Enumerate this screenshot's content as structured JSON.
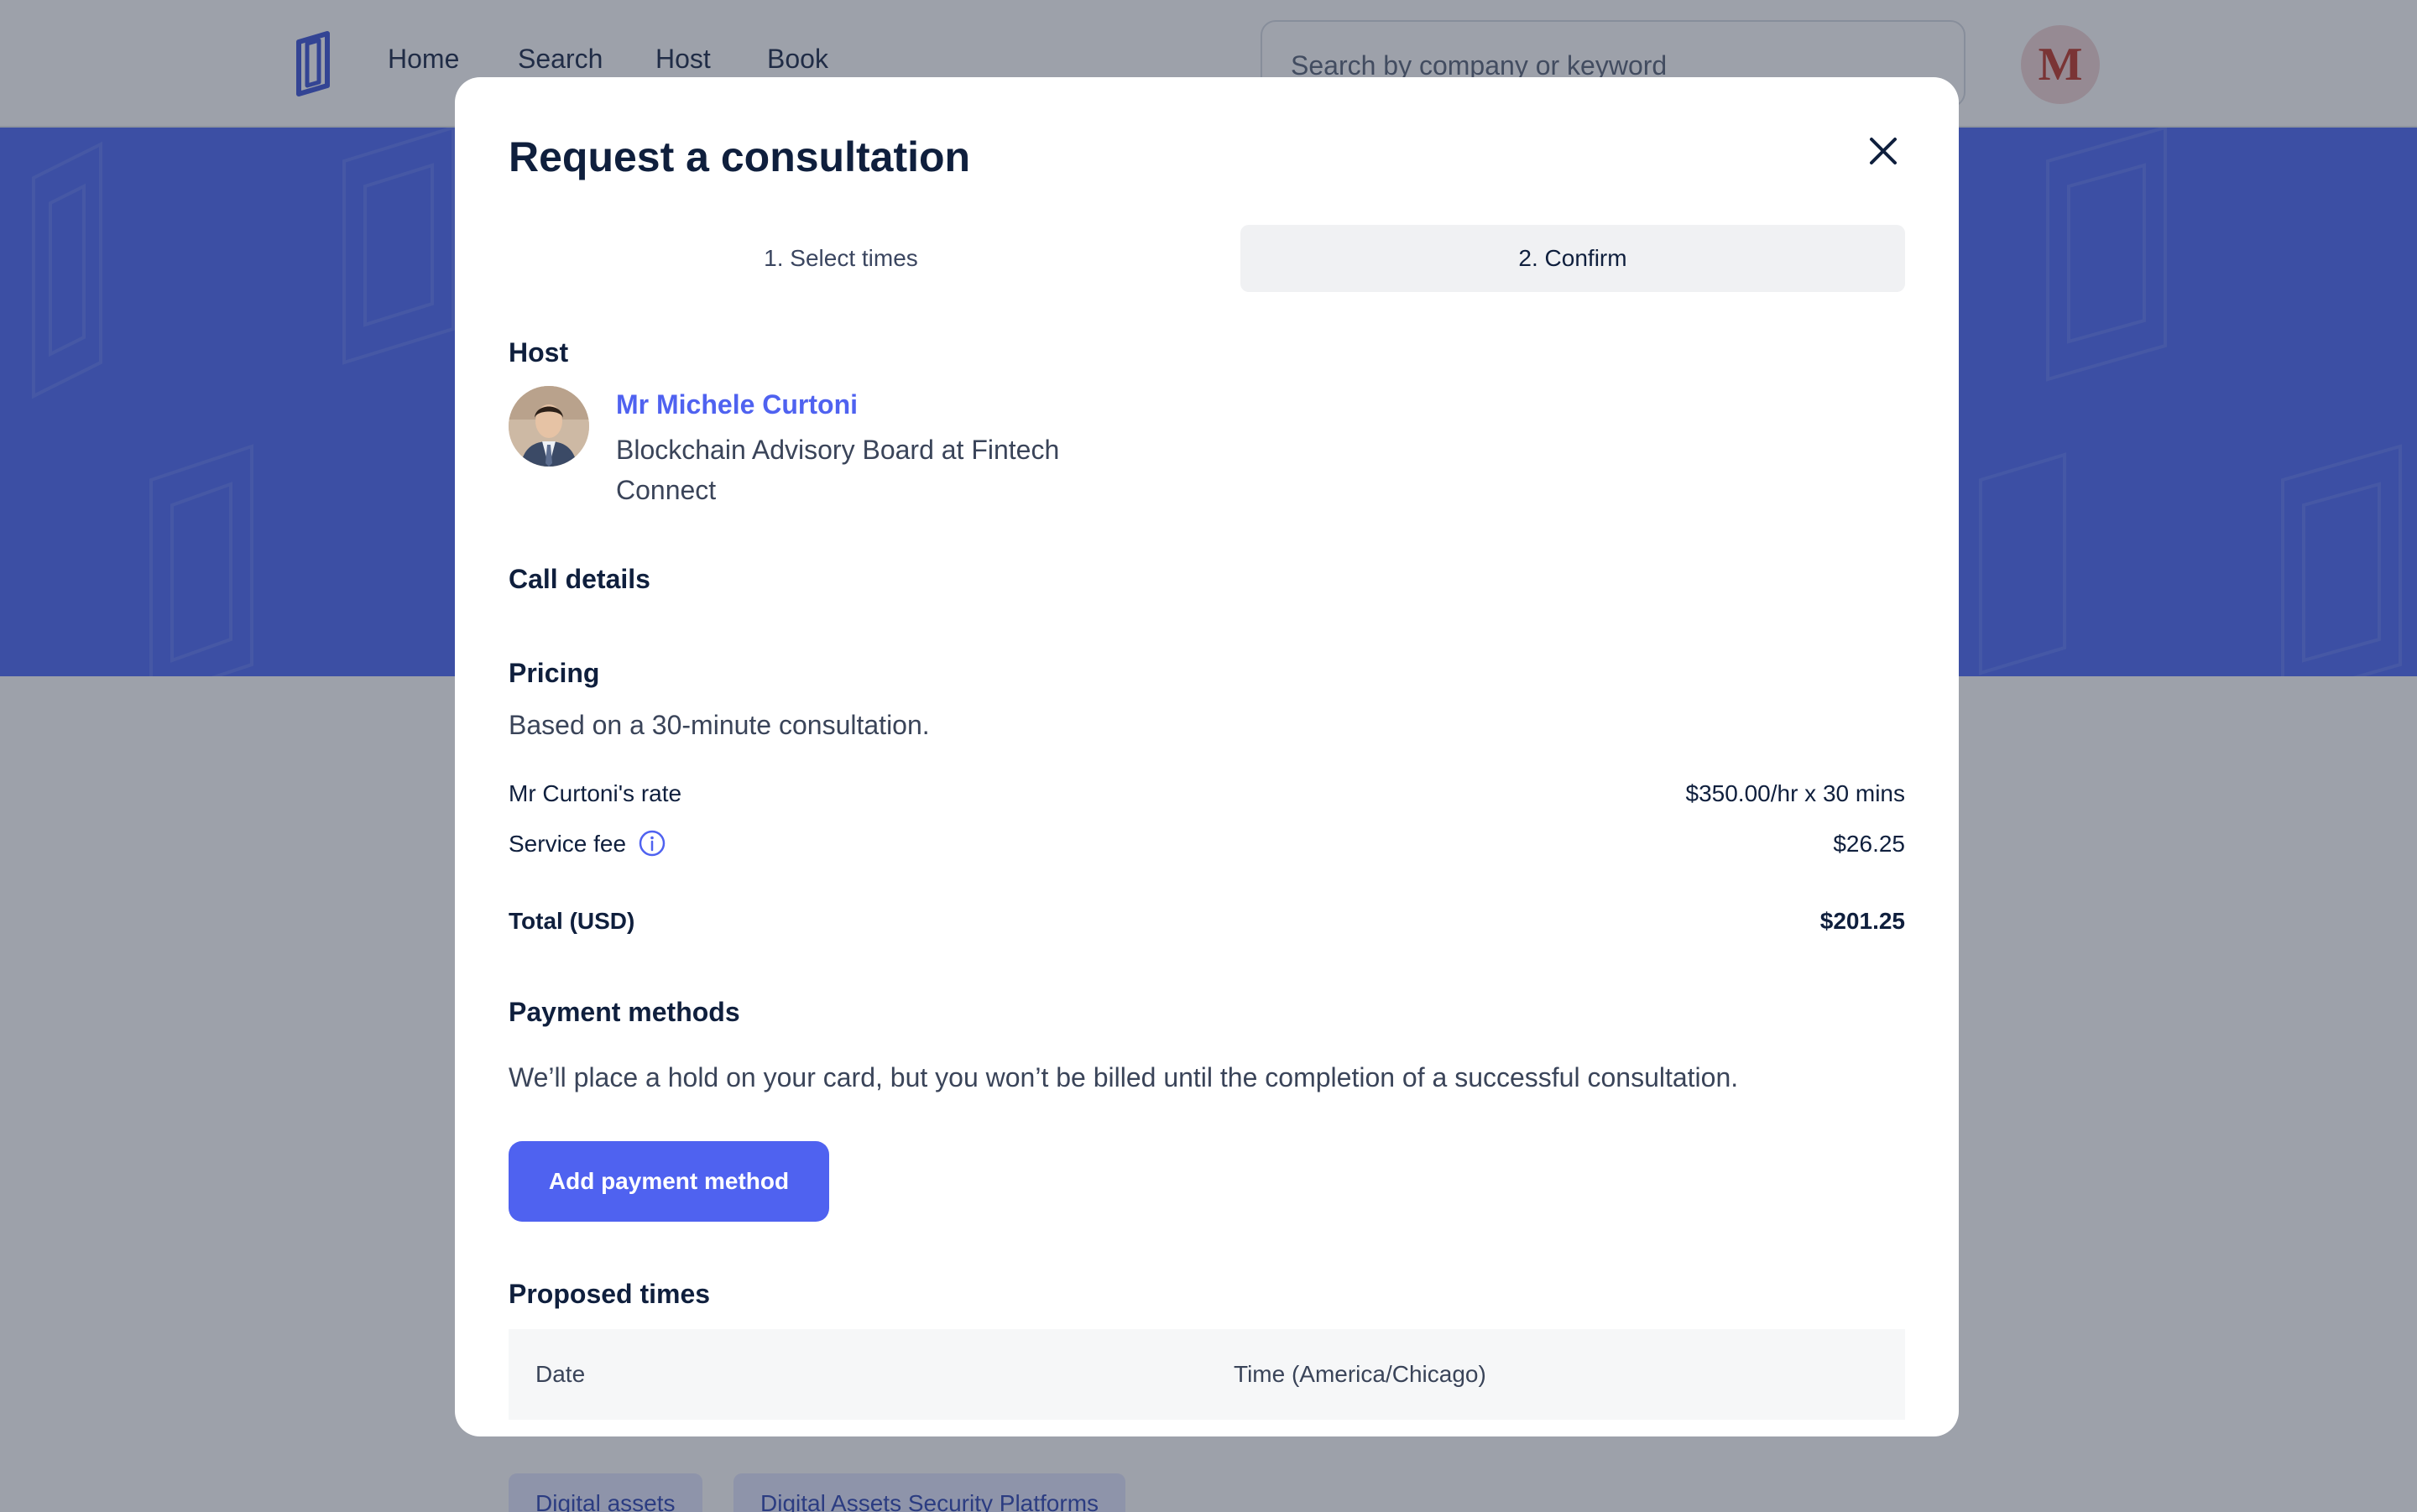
{
  "nav": {
    "links": [
      "Home",
      "Search",
      "Host",
      "Book"
    ],
    "search_placeholder": "Search by company or keyword",
    "avatar_initial": "M"
  },
  "background_chips": [
    "Digital assets",
    "Digital Assets Security Platforms"
  ],
  "modal": {
    "title": "Request a consultation",
    "steps": [
      "1. Select times",
      "2. Confirm"
    ],
    "active_step": 2,
    "host": {
      "section_title": "Host",
      "name": "Mr Michele Curtoni",
      "role": "Blockchain Advisory Board at Fintech Connect"
    },
    "call_details_title": "Call details",
    "pricing": {
      "title": "Pricing",
      "description": "Based on a 30-minute consultation.",
      "rate_label": "Mr Curtoni's rate",
      "rate_value": "$350.00/hr x 30 mins",
      "fee_label": "Service fee",
      "fee_value": "$26.25",
      "total_label": "Total (USD)",
      "total_value": "$201.25"
    },
    "payment": {
      "title": "Payment methods",
      "description": "We’ll place a hold on your card, but you won’t be billed until the completion of a successful consultation.",
      "button_label": "Add payment method"
    },
    "proposed_times": {
      "title": "Proposed times",
      "columns": [
        "Date",
        "Time (America/Chicago)"
      ]
    }
  },
  "colors": {
    "accent": "#4f62f0",
    "hero": "#4f6bf5",
    "overlay": "#262f42"
  }
}
